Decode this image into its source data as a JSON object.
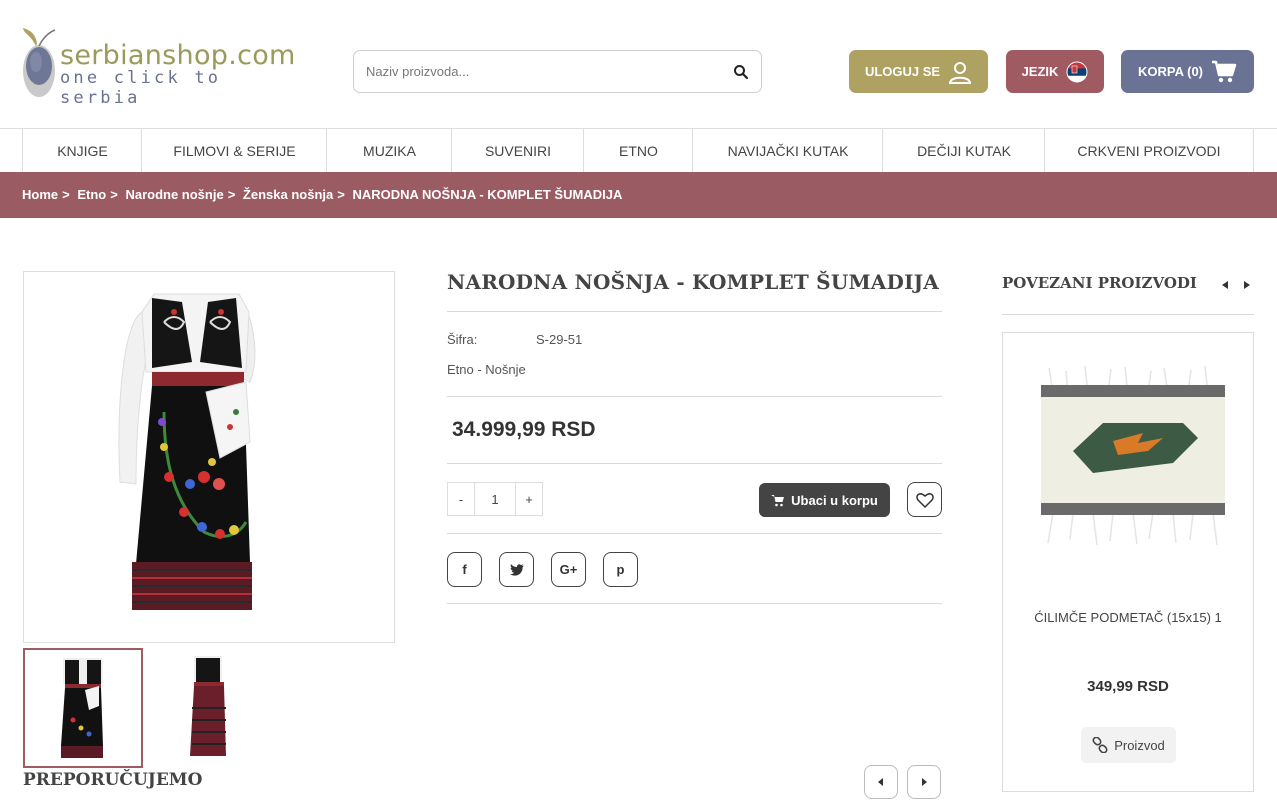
{
  "header": {
    "logo": {
      "title": "serbianshop.com",
      "tagline": "one click to serbia"
    },
    "search": {
      "placeholder": "Naziv proizvoda...",
      "value": ""
    },
    "login_label": "ULOGUJ SE",
    "language_label": "JEZIK",
    "cart_label": "KORPA (0)"
  },
  "nav": {
    "items": [
      {
        "label": "KNJIGE"
      },
      {
        "label": "FILMOVI & SERIJE"
      },
      {
        "label": "MUZIKA"
      },
      {
        "label": "SUVENIRI"
      },
      {
        "label": "ETNO"
      },
      {
        "label": "NAVIJAČKI KUTAK"
      },
      {
        "label": "DEČIJI KUTAK"
      },
      {
        "label": "CRKVENI PROIZVODI"
      }
    ]
  },
  "breadcrumb": {
    "items": [
      "Home",
      ">",
      "Etno",
      ">",
      "Narodne nošnje",
      ">",
      "Ženska nošnja",
      ">",
      "NARODNA NOŠNJA - KOMPLET ŠUMADIJA"
    ]
  },
  "product": {
    "title": "NARODNA NOŠNJA - KOMPLET ŠUMADIJA",
    "sku_label": "Šifra:",
    "sku_value": "S-29-51",
    "category": "Etno - Nošnje",
    "price": "34.999,99 RSD",
    "qty_minus": "-",
    "qty_value": "1",
    "qty_plus": "+",
    "add_to_cart_label": "Ubaci u korpu",
    "social": [
      "f",
      "t",
      "G+",
      "p"
    ]
  },
  "related": {
    "title": "POVEZANI PROIZVODI",
    "item": {
      "name": "ĆILIMČE PODMETAČ (15x15) 1",
      "price": "349,99 RSD",
      "button_label": "Proizvod"
    }
  },
  "recommend": {
    "title": "PREPORUČUJEMO"
  },
  "colors": {
    "accent_olive": "#aea162",
    "accent_wine": "#a05a62",
    "accent_slate": "#6b7395",
    "breadcrumb_bg": "#9b5b63",
    "dark_button": "#444444"
  }
}
